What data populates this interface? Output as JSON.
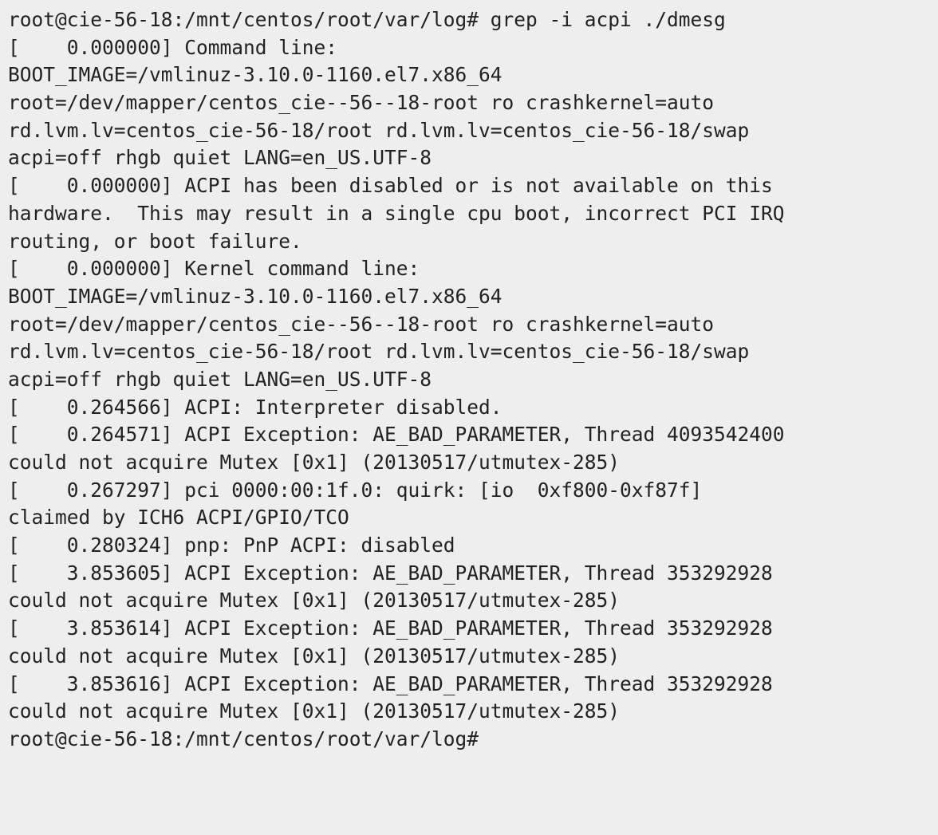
{
  "terminal": {
    "background": "#eeeeee",
    "foreground": "#222222",
    "lines": [
      "root@cie-56-18:/mnt/centos/root/var/log# grep -i acpi ./dmesg",
      "[    0.000000] Command line:",
      "BOOT_IMAGE=/vmlinuz-3.10.0-1160.el7.x86_64",
      "root=/dev/mapper/centos_cie--56--18-root ro crashkernel=auto",
      "rd.lvm.lv=centos_cie-56-18/root rd.lvm.lv=centos_cie-56-18/swap",
      "acpi=off rhgb quiet LANG=en_US.UTF-8",
      "[    0.000000] ACPI has been disabled or is not available on this",
      "hardware.  This may result in a single cpu boot, incorrect PCI IRQ",
      "routing, or boot failure.",
      "[    0.000000] Kernel command line:",
      "BOOT_IMAGE=/vmlinuz-3.10.0-1160.el7.x86_64",
      "root=/dev/mapper/centos_cie--56--18-root ro crashkernel=auto",
      "rd.lvm.lv=centos_cie-56-18/root rd.lvm.lv=centos_cie-56-18/swap",
      "acpi=off rhgb quiet LANG=en_US.UTF-8",
      "[    0.264566] ACPI: Interpreter disabled.",
      "[    0.264571] ACPI Exception: AE_BAD_PARAMETER, Thread 4093542400",
      "could not acquire Mutex [0x1] (20130517/utmutex-285)",
      "[    0.267297] pci 0000:00:1f.0: quirk: [io  0xf800-0xf87f]",
      "claimed by ICH6 ACPI/GPIO/TCO",
      "[    0.280324] pnp: PnP ACPI: disabled",
      "[    3.853605] ACPI Exception: AE_BAD_PARAMETER, Thread 353292928",
      "could not acquire Mutex [0x1] (20130517/utmutex-285)",
      "[    3.853614] ACPI Exception: AE_BAD_PARAMETER, Thread 353292928",
      "could not acquire Mutex [0x1] (20130517/utmutex-285)",
      "[    3.853616] ACPI Exception: AE_BAD_PARAMETER, Thread 353292928",
      "could not acquire Mutex [0x1] (20130517/utmutex-285)",
      "root@cie-56-18:/mnt/centos/root/var/log# "
    ]
  }
}
